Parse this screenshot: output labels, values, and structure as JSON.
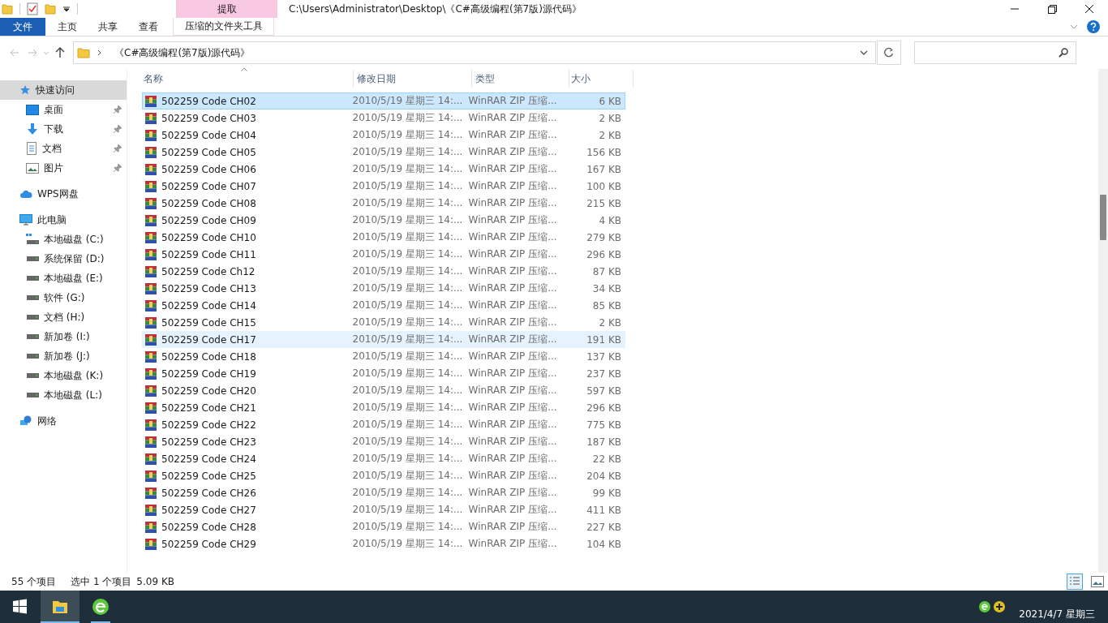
{
  "window": {
    "title": "C:\\Users\\Administrator\\Desktop\\《C#高级编程(第7版)源代码》"
  },
  "ribbon": {
    "context_group": "提取",
    "tabs": [
      {
        "label": "文件",
        "selected": true,
        "kind": "file"
      },
      {
        "label": "主页",
        "selected": false,
        "kind": "tab"
      },
      {
        "label": "共享",
        "selected": false,
        "kind": "tab"
      },
      {
        "label": "查看",
        "selected": false,
        "kind": "tab"
      },
      {
        "label": "压缩的文件夹工具",
        "selected": false,
        "kind": "context"
      }
    ]
  },
  "address_bar": {
    "path": "《C#高级编程(第7版)源代码》"
  },
  "sidebar": {
    "items": [
      {
        "label": "快速访问",
        "kind": "star",
        "selected": true,
        "children": [
          {
            "label": "桌面",
            "kind": "desktop",
            "pinned": true
          },
          {
            "label": "下载",
            "kind": "download",
            "pinned": true
          },
          {
            "label": "文档",
            "kind": "document",
            "pinned": true
          },
          {
            "label": "图片",
            "kind": "pictures",
            "pinned": true
          }
        ]
      },
      {
        "label": "WPS网盘",
        "kind": "cloud",
        "selected": false
      },
      {
        "label": "此电脑",
        "kind": "computer",
        "selected": false,
        "children": [
          {
            "label": "本地磁盘 (C:)",
            "kind": "system-drive",
            "pinned": false
          },
          {
            "label": "系统保留 (D:)",
            "kind": "drive",
            "pinned": false
          },
          {
            "label": "本地磁盘 (E:)",
            "kind": "drive",
            "pinned": false
          },
          {
            "label": "软件 (G:)",
            "kind": "drive",
            "pinned": false
          },
          {
            "label": "文档 (H:)",
            "kind": "drive",
            "pinned": false
          },
          {
            "label": "新加卷 (I:)",
            "kind": "drive",
            "pinned": false
          },
          {
            "label": "新加卷 (J:)",
            "kind": "drive",
            "pinned": false
          },
          {
            "label": "本地磁盘 (K:)",
            "kind": "drive",
            "pinned": false
          },
          {
            "label": "本地磁盘 (L:)",
            "kind": "drive",
            "pinned": false
          }
        ]
      },
      {
        "label": "网络",
        "kind": "network",
        "selected": false
      }
    ]
  },
  "table": {
    "columns": [
      "名称",
      "修改日期",
      "类型",
      "大小"
    ],
    "rows": [
      {
        "name": "502259 Code CH02",
        "date": "2010/5/19 星期三 14:...",
        "type": "WinRAR ZIP 压缩...",
        "size": "6 KB",
        "selected": true,
        "hover": false
      },
      {
        "name": "502259 Code CH03",
        "date": "2010/5/19 星期三 14:...",
        "type": "WinRAR ZIP 压缩...",
        "size": "2 KB",
        "selected": false,
        "hover": false
      },
      {
        "name": "502259 Code CH04",
        "date": "2010/5/19 星期三 14:...",
        "type": "WinRAR ZIP 压缩...",
        "size": "2 KB",
        "selected": false,
        "hover": false
      },
      {
        "name": "502259 Code CH05",
        "date": "2010/5/19 星期三 14:...",
        "type": "WinRAR ZIP 压缩...",
        "size": "156 KB",
        "selected": false,
        "hover": false
      },
      {
        "name": "502259 Code CH06",
        "date": "2010/5/19 星期三 14:...",
        "type": "WinRAR ZIP 压缩...",
        "size": "167 KB",
        "selected": false,
        "hover": false
      },
      {
        "name": "502259 Code CH07",
        "date": "2010/5/19 星期三 14:...",
        "type": "WinRAR ZIP 压缩...",
        "size": "100 KB",
        "selected": false,
        "hover": false
      },
      {
        "name": "502259 Code CH08",
        "date": "2010/5/19 星期三 14:...",
        "type": "WinRAR ZIP 压缩...",
        "size": "215 KB",
        "selected": false,
        "hover": false
      },
      {
        "name": "502259 Code CH09",
        "date": "2010/5/19 星期三 14:...",
        "type": "WinRAR ZIP 压缩...",
        "size": "4 KB",
        "selected": false,
        "hover": false
      },
      {
        "name": "502259 Code CH10",
        "date": "2010/5/19 星期三 14:...",
        "type": "WinRAR ZIP 压缩...",
        "size": "279 KB",
        "selected": false,
        "hover": false
      },
      {
        "name": "502259 Code CH11",
        "date": "2010/5/19 星期三 14:...",
        "type": "WinRAR ZIP 压缩...",
        "size": "296 KB",
        "selected": false,
        "hover": false
      },
      {
        "name": "502259 Code Ch12",
        "date": "2010/5/19 星期三 14:...",
        "type": "WinRAR ZIP 压缩...",
        "size": "87 KB",
        "selected": false,
        "hover": false
      },
      {
        "name": "502259 Code CH13",
        "date": "2010/5/19 星期三 14:...",
        "type": "WinRAR ZIP 压缩...",
        "size": "34 KB",
        "selected": false,
        "hover": false
      },
      {
        "name": "502259 Code CH14",
        "date": "2010/5/19 星期三 14:...",
        "type": "WinRAR ZIP 压缩...",
        "size": "85 KB",
        "selected": false,
        "hover": false
      },
      {
        "name": "502259 Code CH15",
        "date": "2010/5/19 星期三 14:...",
        "type": "WinRAR ZIP 压缩...",
        "size": "2 KB",
        "selected": false,
        "hover": false
      },
      {
        "name": "502259 Code CH17",
        "date": "2010/5/19 星期三 14:...",
        "type": "WinRAR ZIP 压缩...",
        "size": "191 KB",
        "selected": false,
        "hover": true
      },
      {
        "name": "502259 Code CH18",
        "date": "2010/5/19 星期三 14:...",
        "type": "WinRAR ZIP 压缩...",
        "size": "137 KB",
        "selected": false,
        "hover": false
      },
      {
        "name": "502259 Code CH19",
        "date": "2010/5/19 星期三 14:...",
        "type": "WinRAR ZIP 压缩...",
        "size": "237 KB",
        "selected": false,
        "hover": false
      },
      {
        "name": "502259 Code CH20",
        "date": "2010/5/19 星期三 14:...",
        "type": "WinRAR ZIP 压缩...",
        "size": "597 KB",
        "selected": false,
        "hover": false
      },
      {
        "name": "502259 Code CH21",
        "date": "2010/5/19 星期三 14:...",
        "type": "WinRAR ZIP 压缩...",
        "size": "296 KB",
        "selected": false,
        "hover": false
      },
      {
        "name": "502259 Code CH22",
        "date": "2010/5/19 星期三 14:...",
        "type": "WinRAR ZIP 压缩...",
        "size": "775 KB",
        "selected": false,
        "hover": false
      },
      {
        "name": "502259 Code CH23",
        "date": "2010/5/19 星期三 14:...",
        "type": "WinRAR ZIP 压缩...",
        "size": "187 KB",
        "selected": false,
        "hover": false
      },
      {
        "name": "502259 Code CH24",
        "date": "2010/5/19 星期三 14:...",
        "type": "WinRAR ZIP 压缩...",
        "size": "22 KB",
        "selected": false,
        "hover": false
      },
      {
        "name": "502259 Code CH25",
        "date": "2010/5/19 星期三 14:...",
        "type": "WinRAR ZIP 压缩...",
        "size": "204 KB",
        "selected": false,
        "hover": false
      },
      {
        "name": "502259 Code CH26",
        "date": "2010/5/19 星期三 14:...",
        "type": "WinRAR ZIP 压缩...",
        "size": "99 KB",
        "selected": false,
        "hover": false
      },
      {
        "name": "502259 Code CH27",
        "date": "2010/5/19 星期三 14:...",
        "type": "WinRAR ZIP 压缩...",
        "size": "411 KB",
        "selected": false,
        "hover": false
      },
      {
        "name": "502259 Code CH28",
        "date": "2010/5/19 星期三 14:...",
        "type": "WinRAR ZIP 压缩...",
        "size": "227 KB",
        "selected": false,
        "hover": false
      },
      {
        "name": "502259 Code CH29",
        "date": "2010/5/19 星期三 14:...",
        "type": "WinRAR ZIP 压缩...",
        "size": "104 KB",
        "selected": false,
        "hover": false
      }
    ]
  },
  "status_bar": {
    "count": "55 个项目",
    "selection": "选中 1 个项目",
    "size": "5.09 KB"
  },
  "taskbar": {
    "date": "2021/4/7 星期三"
  }
}
